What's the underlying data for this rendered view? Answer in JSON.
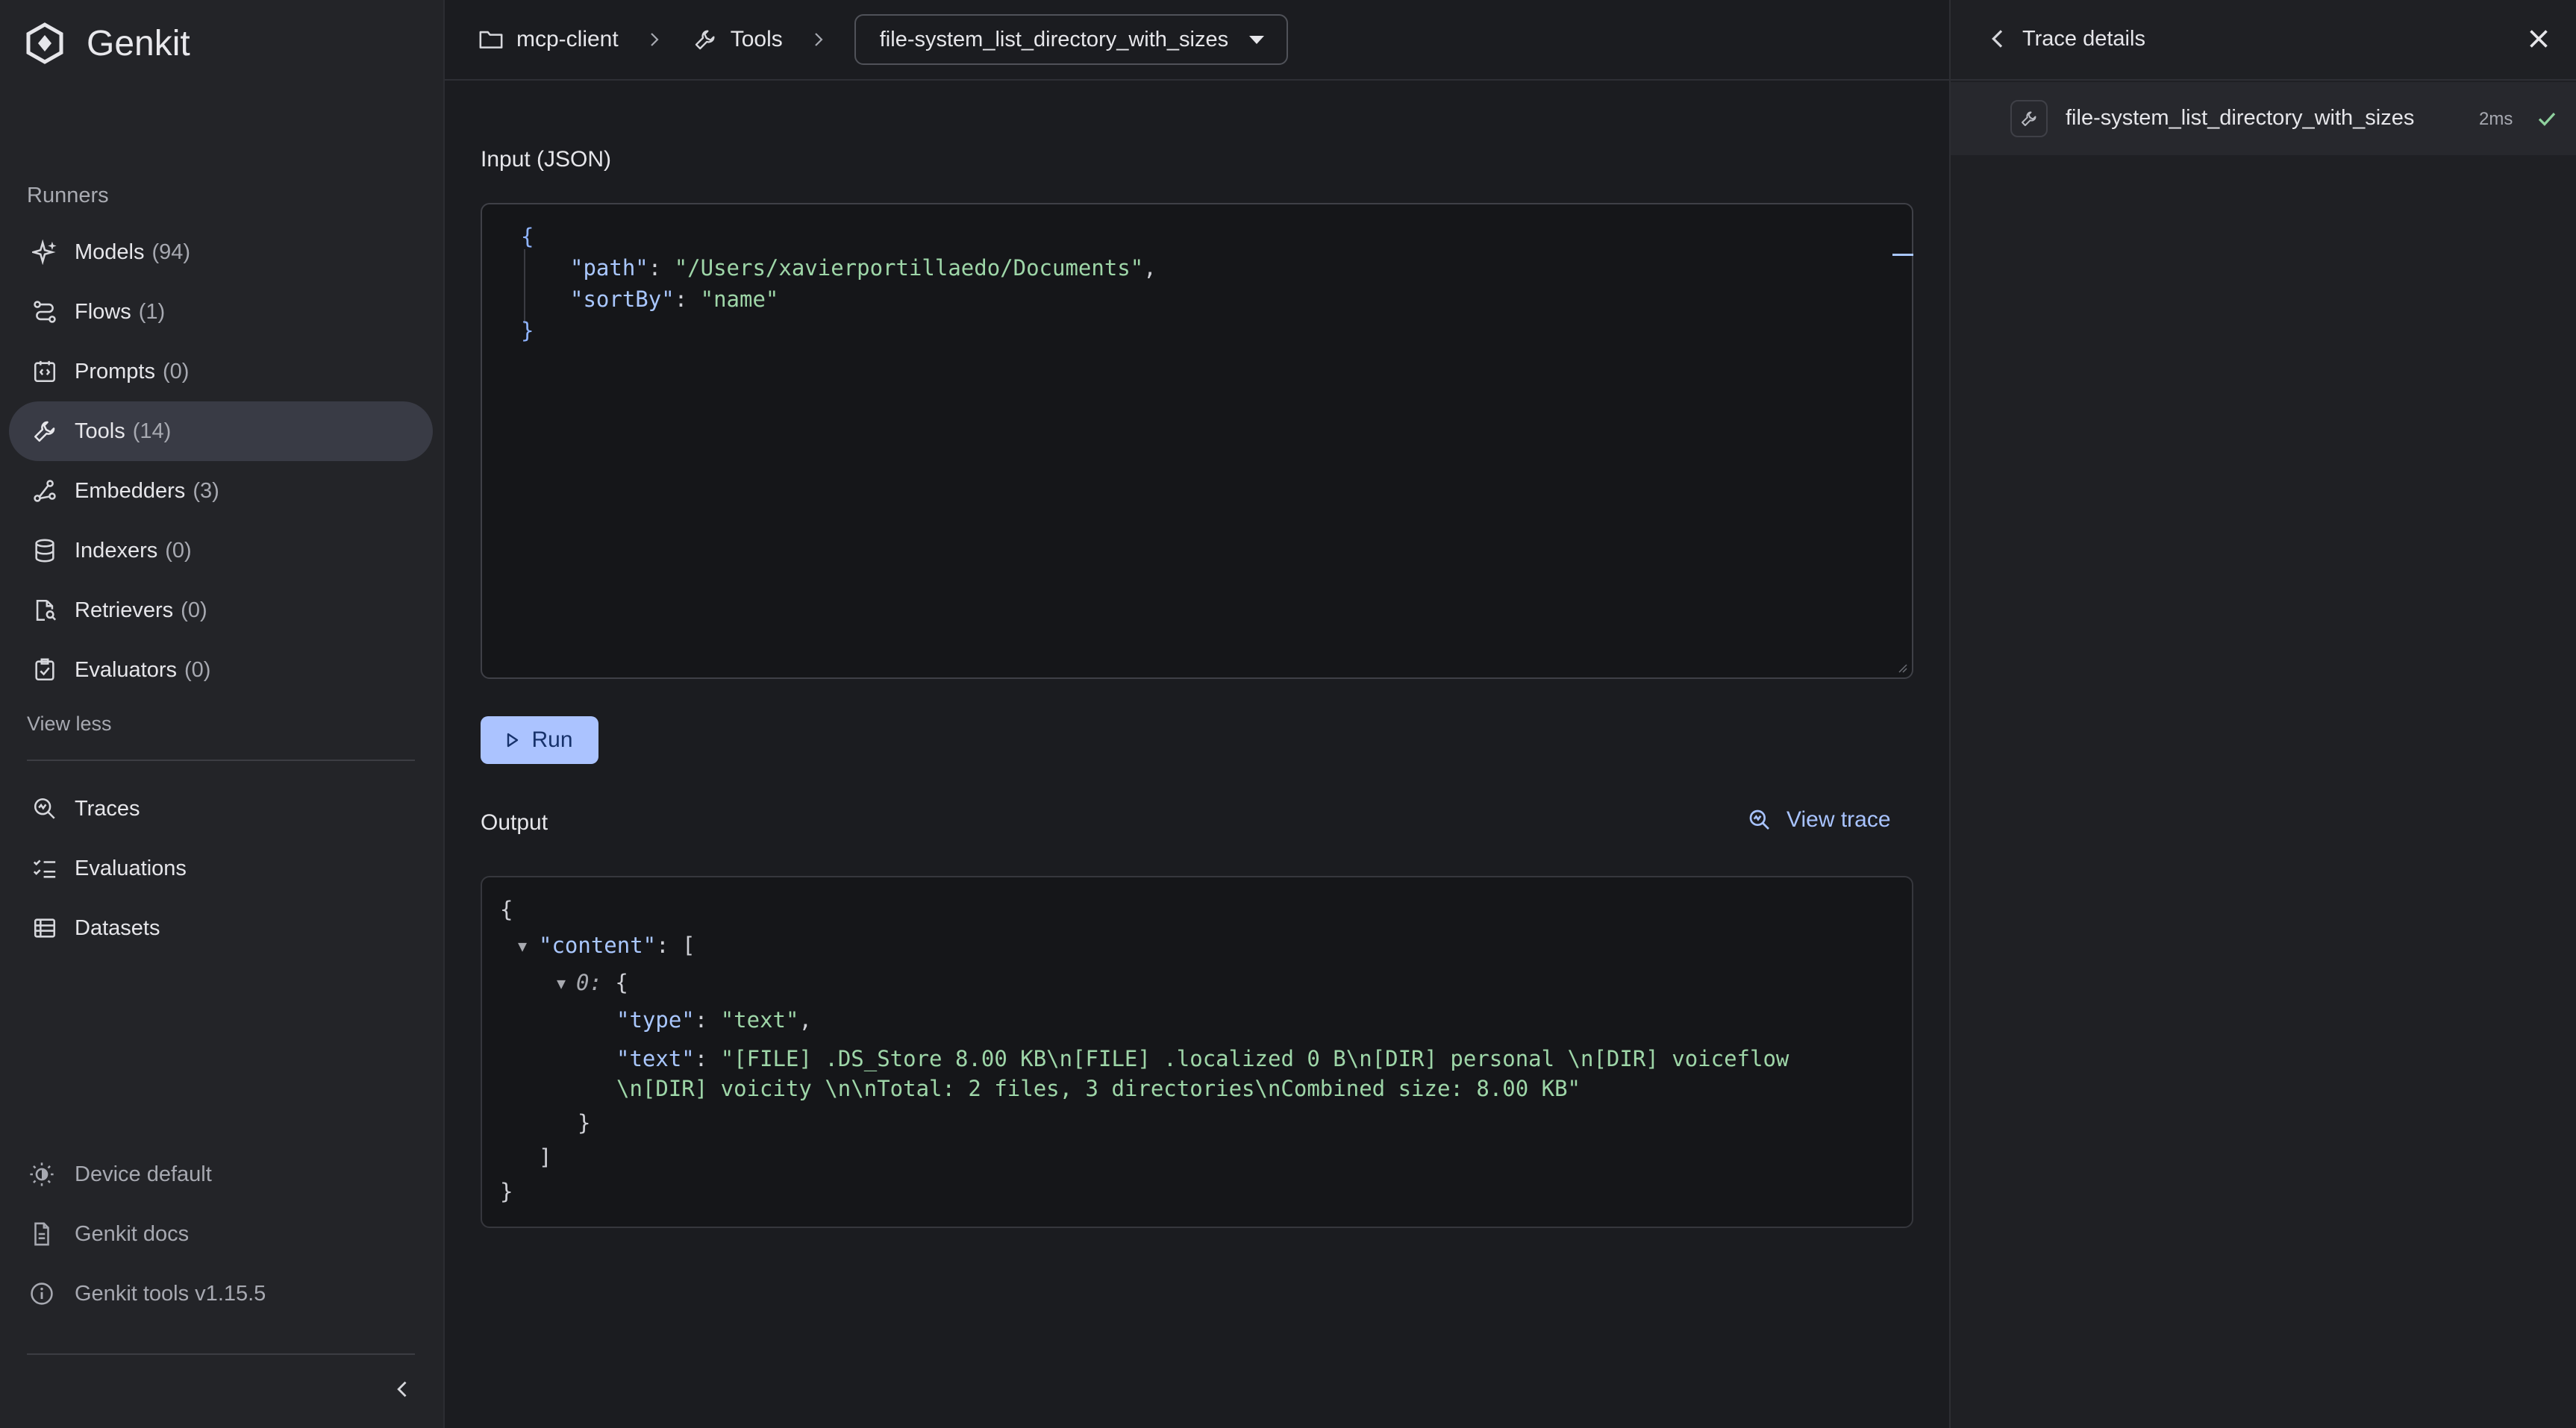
{
  "app": {
    "name": "Genkit"
  },
  "sidebar": {
    "section_label": "Runners",
    "items": [
      {
        "label": "Models",
        "count": "(94)",
        "icon": "sparkle-icon"
      },
      {
        "label": "Flows",
        "count": "(1)",
        "icon": "flow-icon"
      },
      {
        "label": "Prompts",
        "count": "(0)",
        "icon": "prompt-icon"
      },
      {
        "label": "Tools",
        "count": "(14)",
        "icon": "wrench-icon",
        "active": true
      },
      {
        "label": "Embedders",
        "count": "(3)",
        "icon": "embedder-icon"
      },
      {
        "label": "Indexers",
        "count": "(0)",
        "icon": "database-icon"
      },
      {
        "label": "Retrievers",
        "count": "(0)",
        "icon": "retriever-icon"
      },
      {
        "label": "Evaluators",
        "count": "(0)",
        "icon": "evaluator-icon"
      }
    ],
    "view_less": "View less",
    "secondary": [
      {
        "label": "Traces",
        "icon": "trace-search-icon"
      },
      {
        "label": "Evaluations",
        "icon": "checklist-icon"
      },
      {
        "label": "Datasets",
        "icon": "table-icon"
      }
    ],
    "footer": [
      {
        "label": "Device default",
        "icon": "brightness-icon"
      },
      {
        "label": "Genkit docs",
        "icon": "document-icon"
      },
      {
        "label": "Genkit tools v1.15.5",
        "icon": "info-icon"
      }
    ]
  },
  "breadcrumb": {
    "project": "mcp-client",
    "section": "Tools",
    "selected_tool": "file-system_list_directory_with_sizes"
  },
  "input": {
    "label": "Input (JSON)",
    "lines": {
      "open": "{",
      "path_key": "\"path\"",
      "path_value": "\"/Users/xavierportillaedo/Documents\"",
      "sort_key": "\"sortBy\"",
      "sort_value": "\"name\"",
      "close": "}"
    }
  },
  "run_button": "Run",
  "output": {
    "label": "Output",
    "view_trace": "View trace",
    "lines": {
      "open": "{",
      "content_key": "\"content\"",
      "bracket_open": "[",
      "index": "0:",
      "obj_open": "{",
      "type_key": "\"type\"",
      "type_value": "\"text\"",
      "text_key": "\"text\"",
      "text_value_line1": "\"[FILE] .DS_Store 8.00 KB\\n[FILE] .localized 0 B\\n[DIR] personal \\n[DIR] voiceflow",
      "text_value_line2": "\\n[DIR] voicity \\n\\nTotal: 2 files, 3 directories\\nCombined size: 8.00 KB\"",
      "obj_close": "}",
      "bracket_close": "]",
      "close": "}"
    }
  },
  "trace_panel": {
    "title": "Trace details",
    "span_name": "file-system_list_directory_with_sizes",
    "duration": "2ms",
    "status": "success"
  }
}
